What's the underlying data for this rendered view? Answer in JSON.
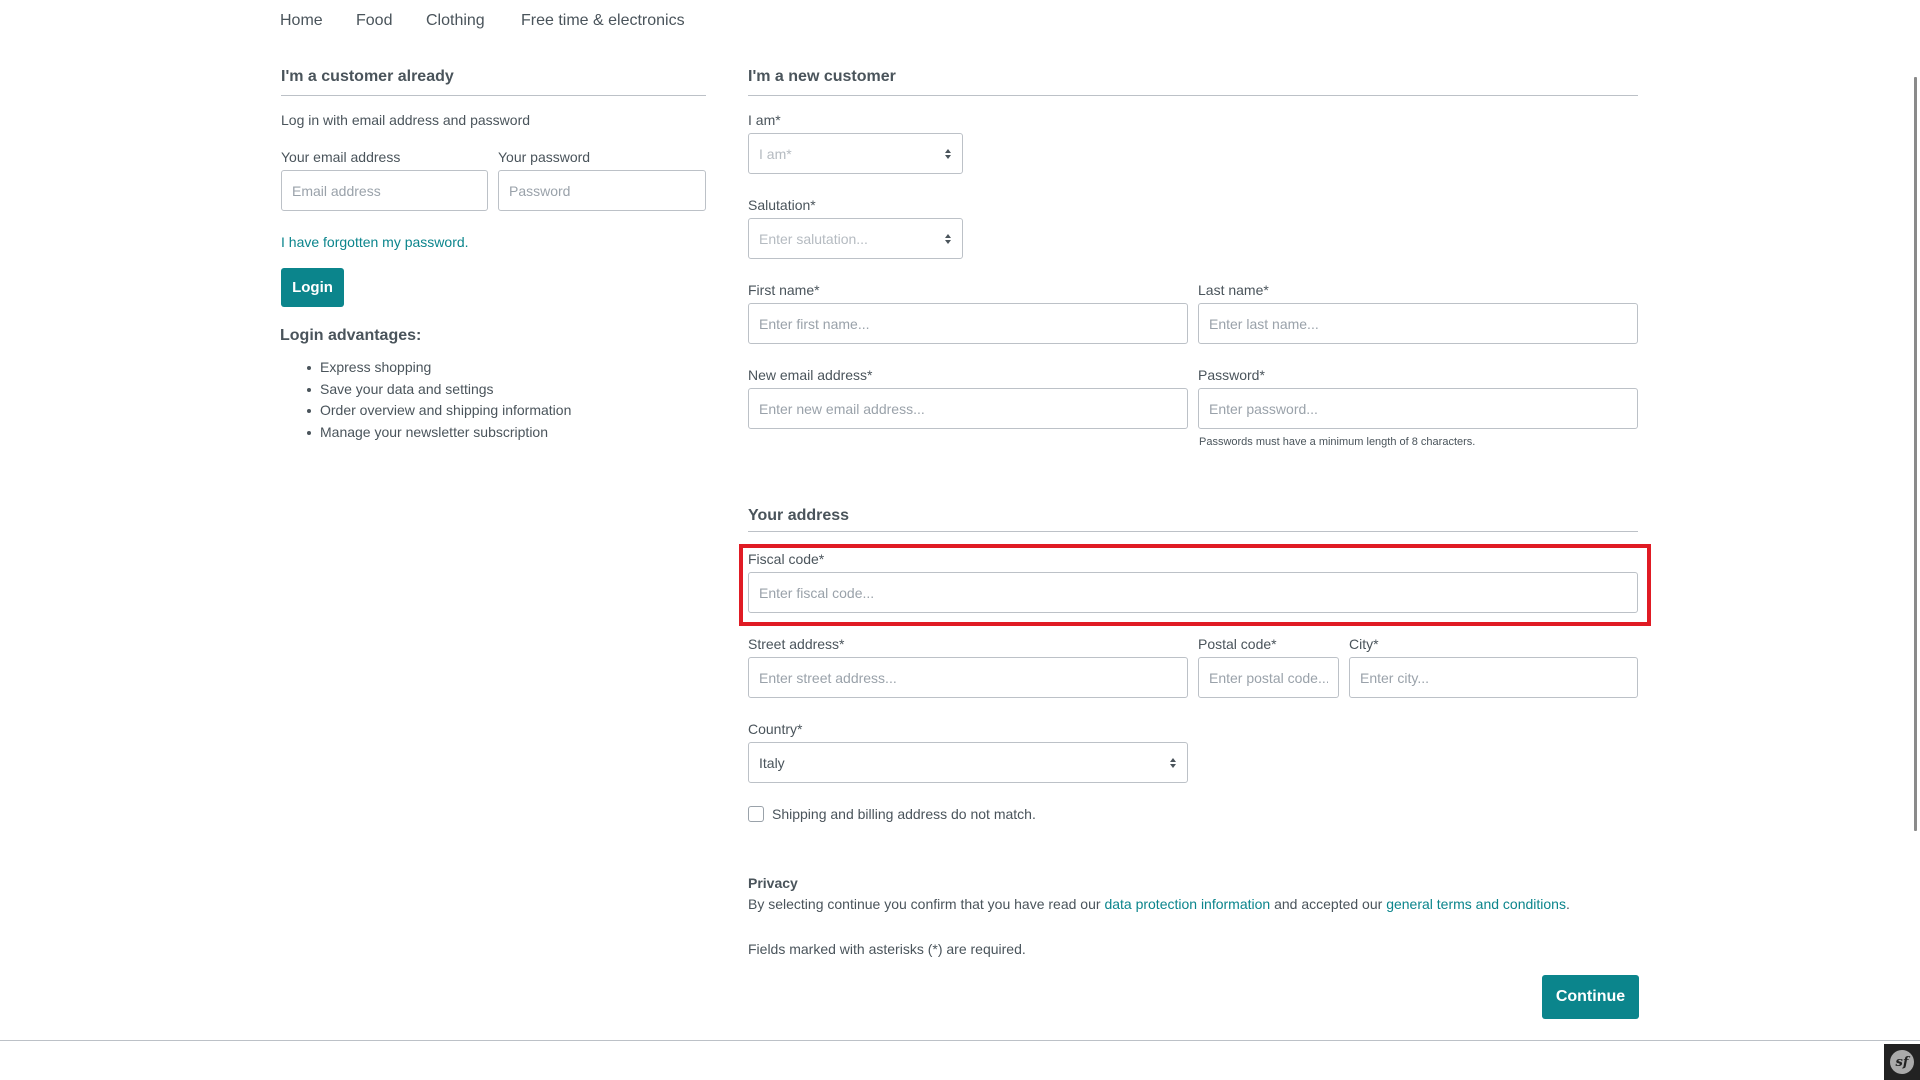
{
  "nav": {
    "items": [
      {
        "label": "Home"
      },
      {
        "label": "Food"
      },
      {
        "label": "Clothing"
      },
      {
        "label": "Free time & electronics"
      }
    ]
  },
  "login": {
    "heading": "I'm a customer already",
    "intro": "Log in with email address and password",
    "email_label": "Your email address",
    "email_placeholder": "Email address",
    "email_value": "",
    "password_label": "Your password",
    "password_placeholder": "Password",
    "password_value": "",
    "forgot_link": "I have forgotten my password.",
    "login_button": "Login",
    "advantages_heading": "Login advantages:",
    "advantages": [
      "Express shopping",
      "Save your data and settings",
      "Order overview and shipping information",
      "Manage your newsletter subscription"
    ]
  },
  "register": {
    "heading": "I'm a new customer",
    "account_type_label": "I am*",
    "account_type_value": "I am*",
    "salutation_label": "Salutation*",
    "salutation_value": "Enter salutation...",
    "first_name_label": "First name*",
    "first_name_placeholder": "Enter first name...",
    "last_name_label": "Last name*",
    "last_name_placeholder": "Enter last name...",
    "email_label": "New email address*",
    "email_placeholder": "Enter new email address...",
    "password_label": "Password*",
    "password_placeholder": "Enter password...",
    "password_hint": "Passwords must have a minimum length of 8 characters.",
    "address": {
      "heading": "Your address",
      "fiscal_code_label": "Fiscal code*",
      "fiscal_code_placeholder": "Enter fiscal code...",
      "street_label": "Street address*",
      "street_placeholder": "Enter street address...",
      "postal_label": "Postal code*",
      "postal_placeholder": "Enter postal code...",
      "city_label": "City*",
      "city_placeholder": "Enter city...",
      "country_label": "Country*",
      "country_value": "Italy",
      "different_shipping_label": "Shipping and billing address do not match.",
      "different_shipping_checked": false
    },
    "privacy": {
      "heading": "Privacy",
      "text_before": "By selecting continue you confirm that you have read our ",
      "data_protection_link": "data protection information",
      "text_middle": " and accepted our ",
      "terms_link": "general terms and conditions",
      "text_after": "."
    },
    "required_note": "Fields marked with asterisks (*) are required.",
    "continue_button": "Continue"
  },
  "colors": {
    "accent": "#0b858c",
    "text": "#4a545b",
    "border": "#bcc1c7",
    "highlight": "#e01b24"
  }
}
